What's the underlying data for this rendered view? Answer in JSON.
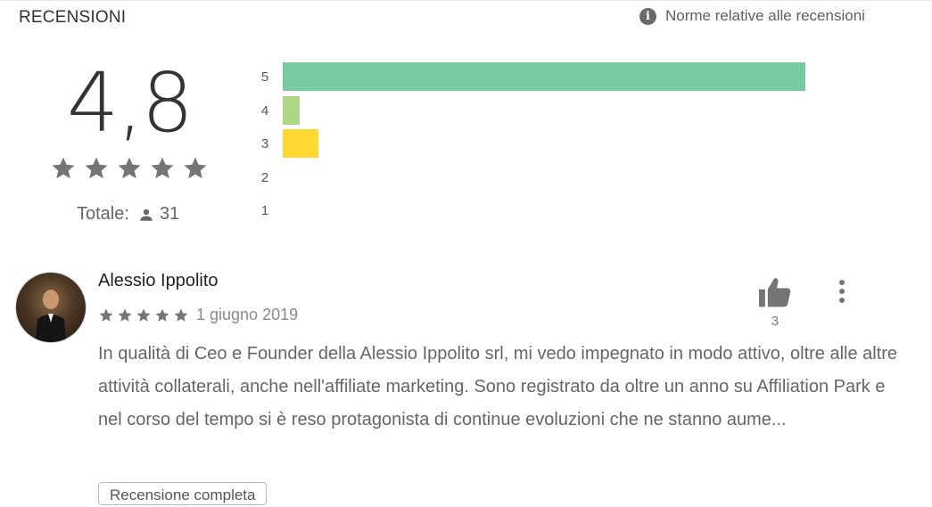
{
  "header": {
    "title": "RECENSIONI",
    "policy_link": "Norme relative alle recensioni",
    "info_icon": "info-icon"
  },
  "summary": {
    "score": "4,8",
    "stars": 5,
    "total_label": "Totale:",
    "total_count": "31",
    "person_icon": "person-icon"
  },
  "histogram": [
    {
      "label": "5",
      "fraction": 0.95,
      "color": "#79c9a1"
    },
    {
      "label": "4",
      "fraction": 0.03,
      "color": "#aed888"
    },
    {
      "label": "3",
      "fraction": 0.065,
      "color": "#ffd834"
    },
    {
      "label": "2",
      "fraction": 0,
      "color": "#ffb234"
    },
    {
      "label": "1",
      "fraction": 0,
      "color": "#ff8c5a"
    }
  ],
  "review": {
    "author": "Alessio Ippolito",
    "rating": 5,
    "date": "1 giugno 2019",
    "thumbs_up_count": "3",
    "text": "In qualità di Ceo e Founder della Alessio Ippolito srl, mi vedo impegnato in modo attivo, oltre alle altre attività collaterali, anche nell'affiliate marketing. Sono registrato da oltre un anno su Affiliation Park e nel corso del tempo si è reso protagonista di continue evoluzioni che ne stanno aume...",
    "full_review_label": "Recensione completa"
  },
  "colors": {
    "star": "#757575",
    "text_secondary": "#666666"
  }
}
